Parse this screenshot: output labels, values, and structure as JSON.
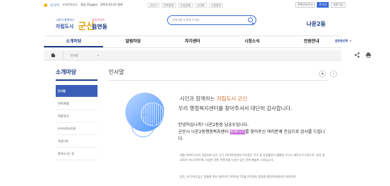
{
  "topbar": {
    "temp": "17.0°C",
    "weather_text": "미세먼지농도",
    "dust": "좋음 22μg/㎥",
    "date": "2023-10-22 현재",
    "links": [
      "군산시",
      "문화관광",
      "산업경제",
      "시의회",
      "시정정보"
    ],
    "right_buttons": [
      "전화번호안내",
      "로그인",
      "회원가입"
    ]
  },
  "header": {
    "slogan": "시민이 행복하는",
    "city_text": "자립도시",
    "logo_gunsan": "군산",
    "tag": "통합콘텐츠",
    "town": "읍면동",
    "search_placeholder": "검색어를 입력해 주세요.",
    "dong": "나운2동"
  },
  "gnb": {
    "items": [
      "소개마당",
      "알림마당",
      "자치센터",
      "시정소식",
      "민원안내"
    ],
    "select_label": "읍면동선택"
  },
  "breadcrumb": {
    "path": "인사말"
  },
  "lnb": {
    "title": "소개마당",
    "items": [
      "인사말",
      "연혁/현황",
      "직원/업무",
      "우리지역사진관",
      "자생단체",
      "찾아오시는 길"
    ]
  },
  "content": {
    "heading": "인사말",
    "greeting_line1_a": "시민과 함께하는 ",
    "greeting_line1_b": "자립도시 군산",
    "greeting_line2": "우리 행정복지센터를 찾아주셔서 대단히 감사합니다.",
    "intro_1": "안녕하십니까? 나운2동장 남궁우입니다.",
    "intro_2a": "군산시 나운2동행정복지센터 ",
    "intro_highlight": "홈페이지",
    "intro_2b": "를 찾아주신 여러분께 진심으로 감사를 드립니다.",
    "para1": "대형 아파트단지가 밀집되어 있는 인구 2만3천여명의 우리동은 주거 및 상업활동이 활발한 우리시 제1의 우수동으로, 청치 및 교육의 선도지역이며, 다양한 문화 컨텐츠를 누릴수 있는 문화 예술의 고장입니다.",
    "para2": "동민, 사각지대 없는 맞춤형 복지 실현으로 2016년 11월 주민센터 명칭을 행정복지센터로 변경하여"
  }
}
